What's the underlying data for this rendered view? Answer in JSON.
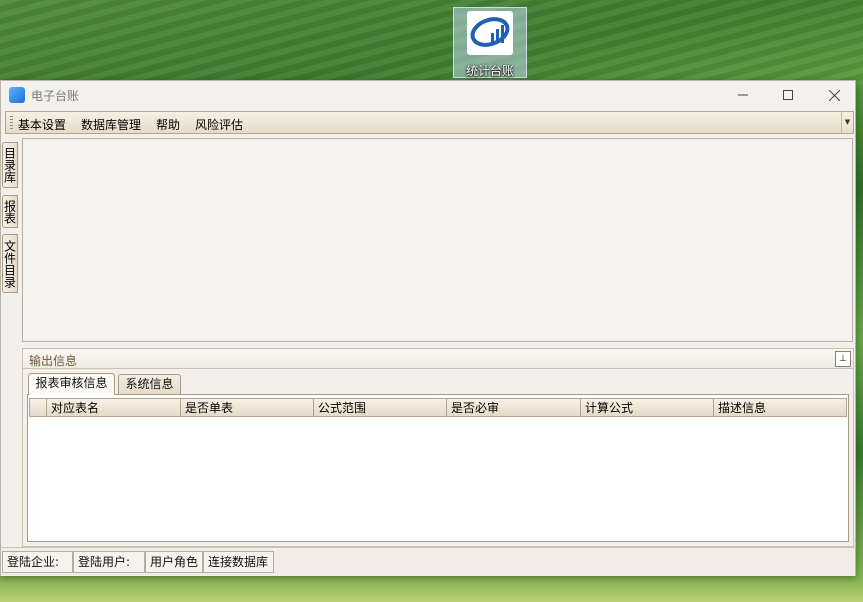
{
  "desktop": {
    "icon_label": "统计台账"
  },
  "window": {
    "title": "电子台账"
  },
  "menu": {
    "items": [
      "基本设置",
      "数据库管理",
      "帮助",
      "风险评估"
    ]
  },
  "side_tabs": [
    "目录库",
    "报表",
    "文件目录"
  ],
  "output_panel": {
    "title": "输出信息",
    "tabs": [
      "报表审核信息",
      "系统信息"
    ],
    "columns": [
      "对应表名",
      "是否单表",
      "公式范围",
      "是否必审",
      "计算公式",
      "描述信息"
    ]
  },
  "statusbar": {
    "company_label": "登陆企业:",
    "user_label": "登陆用户:",
    "role_label": "用户角色",
    "db_label": "连接数据库"
  }
}
